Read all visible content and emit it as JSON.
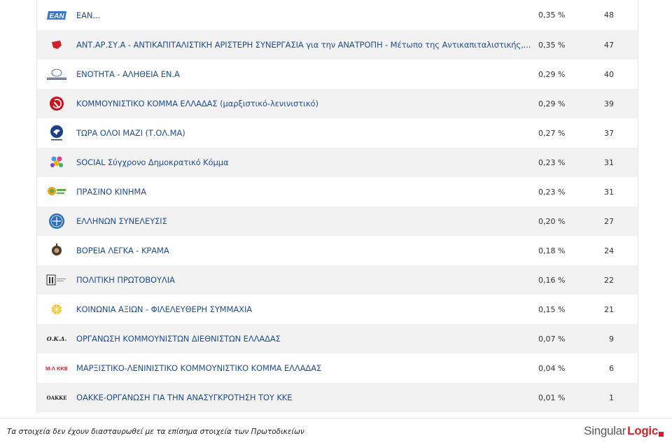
{
  "rows": [
    {
      "name": "ΕΑΝ...",
      "pct": "0,35 %",
      "votes": "48",
      "logo": "ean-logo"
    },
    {
      "name": "ΑΝΤ.ΑΡ.ΣΥ.Α - ΑΝΤΙΚΑΠΙΤΑΛΙΣΤΙΚΗ ΑΡΙΣΤΕΡΗ ΣΥΝΕΡΓΑΣΙΑ για την ΑΝΑΤΡΟΠΗ - Μέτωπο της Αντικαπιταλιστικής,...",
      "pct": "0,35 %",
      "votes": "47",
      "logo": "antarsya-logo"
    },
    {
      "name": "ΕΝΟΤΗΤΑ - ΑΛΗΘΕΙΑ ΕΝ.Α",
      "pct": "0,29 %",
      "votes": "40",
      "logo": "ena-logo"
    },
    {
      "name": "ΚΟΜΜΟΥΝΙΣΤΙΚΟ ΚΟΜΜΑ ΕΛΛΑΔΑΣ (μαρξιστικό-λενινιστικό)",
      "pct": "0,29 %",
      "votes": "39",
      "logo": "kke-ml-logo"
    },
    {
      "name": "ΤΩΡΑ ΟΛΟΙ ΜΑΖΙ (Τ.ΟΛ.ΜΑ)",
      "pct": "0,27 %",
      "votes": "37",
      "logo": "tolma-logo"
    },
    {
      "name": "SOCIAL Σύγχρονο Δημοκρατικό Κόμμα",
      "pct": "0,23 %",
      "votes": "31",
      "logo": "social-logo"
    },
    {
      "name": "ΠΡΑΣΙΝΟ ΚΙΝΗΜΑ",
      "pct": "0,23 %",
      "votes": "31",
      "logo": "prasino-logo"
    },
    {
      "name": "ΕΛΛΗΝΩΝ ΣΥΝΕΛΕΥΣΙΣ",
      "pct": "0,20 %",
      "votes": "27",
      "logo": "ellinon-logo"
    },
    {
      "name": "ΒΟΡΕΙΑ ΛΕΓΚΑ - ΚΡΑΜΑ",
      "pct": "0,18 %",
      "votes": "24",
      "logo": "kraμa-logo"
    },
    {
      "name": "ΠΟΛΙΤΙΚΗ ΠΡΩΤΟΒΟΥΛΙΑ",
      "pct": "0,16 %",
      "votes": "22",
      "logo": "protovoulia-logo"
    },
    {
      "name": "ΚΟΙΝΩΝΙΑ ΑΞΙΩΝ - ΦΙΛΕΛΕΥΘΕΡΗ ΣΥΜΜΑΧΙΑ",
      "pct": "0,15 %",
      "votes": "21",
      "logo": "koinonia-logo"
    },
    {
      "name": "ΟΡΓΑΝΩΣΗ ΚΟΜΜΟΥΝΙΣΤΩΝ ΔΙΕΘΝΙΣΤΩΝ ΕΛΛΑΔΑΣ",
      "pct": "0,07 %",
      "votes": "9",
      "logo": "okd-logo",
      "logo_text": "Ο.Κ.Δ."
    },
    {
      "name": "ΜΑΡΞΙΣΤΙΚΟ-ΛΕΝΙΝΙΣΤΙΚΟ ΚΟΜΜΟΥΝΙΣΤΙΚΟ ΚΟΜΜΑ ΕΛΛΑΔΑΣ",
      "pct": "0,04 %",
      "votes": "6",
      "logo": "mlkke-logo",
      "logo_text": "Μ-Λ ΚΚΕ"
    },
    {
      "name": "ΟΑΚΚΕ-ΟΡΓΑΝΩΣΗ ΓΙΑ ΤΗΝ ΑΝΑΣΥΓΚΡΟΤΗΣΗ ΤΟΥ ΚΚΕ",
      "pct": "0,01 %",
      "votes": "1",
      "logo": "oakke-logo",
      "logo_text": "ΟΑΚΚΕ"
    }
  ],
  "footer": {
    "note": "Τα στοιχεία δεν έχουν διασταυρωθεί με τα επίσημα στοιχεία των Πρωτοδικείων",
    "brand_a": "Singular",
    "brand_b": "Logic"
  },
  "colors": {
    "link": "#1f4e8c",
    "row_alt": "#f2f2f2",
    "brand_red": "#d6202a"
  }
}
